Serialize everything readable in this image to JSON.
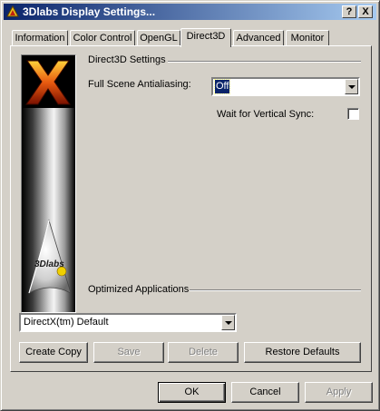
{
  "window": {
    "title": "3Dlabs Display Settings..."
  },
  "titlebar_buttons": {
    "help": "?",
    "close": "X"
  },
  "tabs": [
    {
      "label": "Information"
    },
    {
      "label": "Color Control"
    },
    {
      "label": "OpenGL"
    },
    {
      "label": "Direct3D",
      "active": true
    },
    {
      "label": "Advanced"
    },
    {
      "label": "Monitor"
    }
  ],
  "banner": {
    "brand_text": "3Dlabs"
  },
  "direct3d": {
    "group_title": "Direct3D Settings",
    "fsaa_label": "Full Scene Antialiasing:",
    "fsaa_value": "Off",
    "vsync_label": "Wait for Vertical Sync:",
    "vsync_checked": false
  },
  "optimized": {
    "group_title": "Optimized Applications",
    "selected_app": "DirectX(tm) Default",
    "buttons": {
      "create_copy": "Create Copy",
      "save": "Save",
      "delete": "Delete",
      "restore_defaults": "Restore Defaults"
    }
  },
  "dialog_buttons": {
    "ok": "OK",
    "cancel": "Cancel",
    "apply": "Apply"
  },
  "colors": {
    "titlebar_start": "#0a246a",
    "titlebar_end": "#a6caf0",
    "face": "#d4d0c8"
  }
}
